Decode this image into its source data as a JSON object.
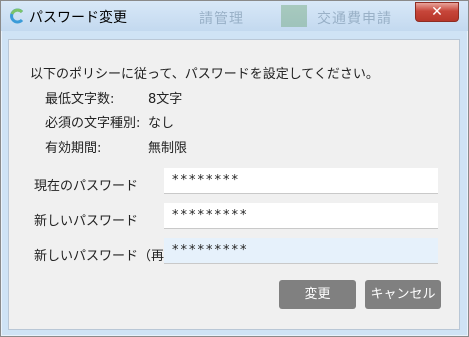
{
  "window": {
    "title": "パスワード変更",
    "close_symbol": "✕",
    "background_text_left": "請管理",
    "background_text_right": "交通費申請"
  },
  "dialog": {
    "intro": "以下のポリシーに従って、パスワードを設定してください。",
    "policy": [
      {
        "label": "最低文字数:",
        "value": "8文字"
      },
      {
        "label": "必須の文字種別:",
        "value": "なし"
      },
      {
        "label": "有効期間:",
        "value": "無制限"
      }
    ],
    "fields": {
      "current": {
        "label": "現在のパスワード",
        "value": "********"
      },
      "new": {
        "label": "新しいパスワード",
        "value": "*********"
      },
      "confirm": {
        "label": "新しいパスワード（再）",
        "value": "*********"
      }
    },
    "buttons": {
      "change": "変更",
      "cancel": "キャンセル"
    }
  },
  "colors": {
    "titlebar": "#c8dcf0",
    "client_bg": "#f0f0f0",
    "button_bg": "#808080",
    "focused_input": "#e6f1fb",
    "close_red": "#c7463a"
  },
  "icons": {
    "app": "app-c-logo-icon",
    "close": "close-icon"
  }
}
